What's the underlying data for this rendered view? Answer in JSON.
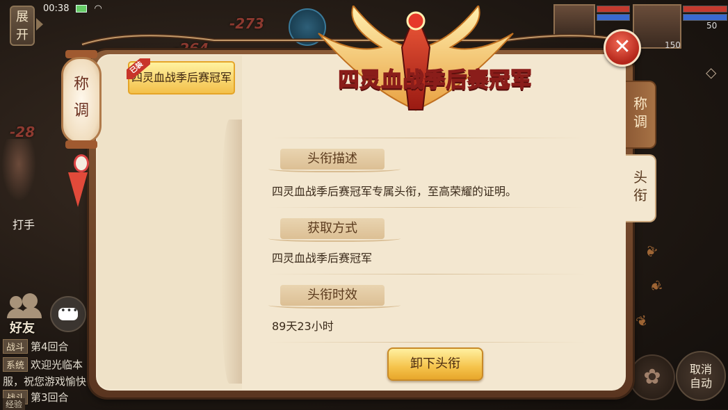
{
  "status_bar": {
    "time": "00:38"
  },
  "hud": {
    "expand_label": "展开",
    "damage_numbers": [
      "-273",
      "-264",
      "-28"
    ],
    "player_level": "150",
    "pet_level": "50",
    "player_name": "打手",
    "friends_label": "好友",
    "auto_button": {
      "line1": "取消",
      "line2": "自动"
    },
    "chat": [
      {
        "tag": "战斗",
        "text": "第4回合"
      },
      {
        "tag": "系统",
        "text": "欢迎光临本"
      },
      {
        "tag": "",
        "text": "服，祝您游戏愉快"
      },
      {
        "tag": "战斗",
        "text": "第3回合"
      }
    ],
    "exp_label": "经验"
  },
  "dialog": {
    "lantern_text": "称调",
    "banner_title": "四灵血战季后赛冠军",
    "title_list": [
      {
        "label": "四灵血战季后赛冠军",
        "equipped_tag": "已装"
      }
    ],
    "tabs": [
      {
        "label": "称调",
        "active": false
      },
      {
        "label": "头衔",
        "active": true
      }
    ],
    "sections": {
      "description": {
        "label": "头衔描述",
        "text": "四灵血战季后赛冠军专属头衔，至高荣耀的证明。"
      },
      "obtain": {
        "label": "获取方式",
        "text": "四灵血战季后赛冠军"
      },
      "duration": {
        "label": "头衔时效",
        "text": "89天23小时"
      }
    },
    "unequip_button": "卸下头衔",
    "close_icon": "close-x-icon"
  },
  "colors": {
    "panel_bg": "#f3e7d0",
    "frame": "#8a5a36",
    "gold_button": "#f5c34b",
    "close_red": "#d4382a",
    "title_text": "#ffdb5a"
  }
}
